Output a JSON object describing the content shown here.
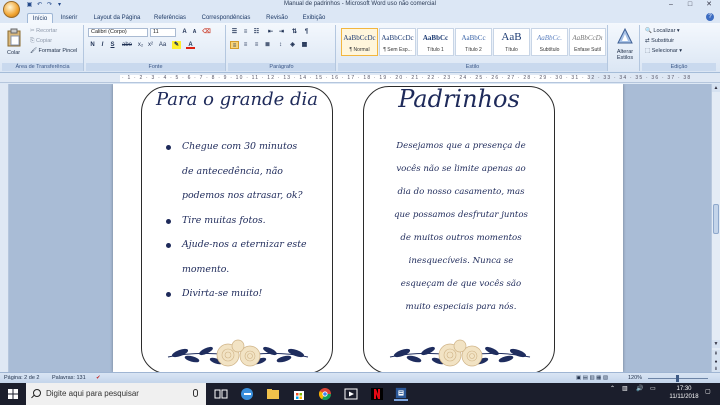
{
  "window": {
    "title": "Manual de padrinhos - Microsoft Word uso não comercial",
    "controls": [
      "–",
      "□",
      "✕"
    ]
  },
  "tabs": [
    "Início",
    "Inserir",
    "Layout da Página",
    "Referências",
    "Correspondências",
    "Revisão",
    "Exibição"
  ],
  "ribbon": {
    "clipboard": {
      "paste_label": "Colar",
      "cut_label": "Recortar",
      "copy_label": "Copiar",
      "format_painter_label": "Formatar Pincel",
      "group_label": "Área de Transferência"
    },
    "font": {
      "font_name": "Calibri (Corpo)",
      "font_size": "11",
      "format_buttons": [
        "N",
        "I",
        "S",
        "abe",
        "x₂",
        "x²",
        "Aa",
        "A"
      ],
      "group_label": "Fonte"
    },
    "paragraph": {
      "group_label": "Parágrafo"
    },
    "styles": {
      "items": [
        {
          "sample": "AaBbCcDc",
          "name": "¶ Normal"
        },
        {
          "sample": "AaBbCcDc",
          "name": "¶ Sem Esp..."
        },
        {
          "sample": "AaBbCc",
          "name": "Título 1"
        },
        {
          "sample": "AaBbCc",
          "name": "Título 2"
        },
        {
          "sample": "AaB",
          "name": "Título"
        },
        {
          "sample": "AaBbCc.",
          "name": "Subtítulo"
        },
        {
          "sample": "AaBbCcDı",
          "name": "Ênfase Sutil"
        }
      ],
      "change_styles_label": "Alterar Estilos",
      "group_label": "Estilo"
    },
    "editing": {
      "find_label": "Localizar",
      "replace_label": "Substituir",
      "select_label": "Selecionar",
      "group_label": "Edição"
    }
  },
  "document": {
    "left_card": {
      "title": "Para o grande dia",
      "bullets": [
        [
          "Chegue com 30 minutos",
          "de antecedência, não",
          "podemos nos atrasar, ok?"
        ],
        [
          "Tire muitas fotos."
        ],
        [
          "Ajude-nos a eternizar este",
          "momento."
        ],
        [
          "Divirta-se muito!"
        ]
      ]
    },
    "right_card": {
      "title": "Padrinhos",
      "paragraph_lines": [
        "Desejamos que a presença de",
        "vocês não se limite apenas ao",
        "dia do nosso casamento, mas",
        "que possamos desfrutar juntos",
        "de muitos outros momentos",
        "inesquecíveis. Nunca se",
        "esqueçam de que vocês são",
        "muito especiais para nós."
      ]
    }
  },
  "statusbar": {
    "page": "Página: 2 de 2",
    "words": "Palavras: 131",
    "zoom": "120%"
  },
  "taskbar": {
    "search_placeholder": "Digite aqui para pesquisar",
    "time": "17:30",
    "date": "11/11/2018"
  },
  "colors": {
    "ink": "#1e2a5a",
    "ribbon_bg": "#dbe6f4",
    "taskbar_bg": "#1b1e2c"
  }
}
